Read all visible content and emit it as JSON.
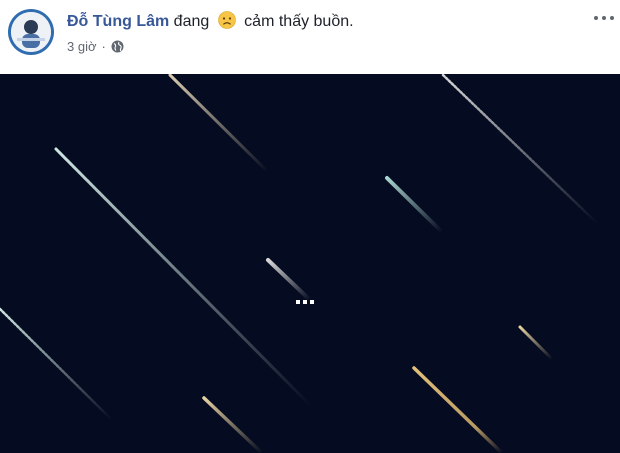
{
  "post": {
    "author_name": "Đỗ Tùng Lâm",
    "status_prefix": "đang",
    "feeling": "cảm thấy buồn.",
    "timestamp": "3 giờ",
    "separator": "·",
    "privacy_icon": "globe-icon",
    "feeling_icon": "sad-face-icon",
    "menu_icon": "more-options-icon"
  },
  "colors": {
    "author_link": "#385898",
    "meta_text": "#616770",
    "media_background": "#050b20",
    "loading_dots": "#ffffff"
  },
  "media": {
    "type": "shooting-stars animation",
    "state": "loading",
    "loading_icon": "loading-dots-icon"
  }
}
